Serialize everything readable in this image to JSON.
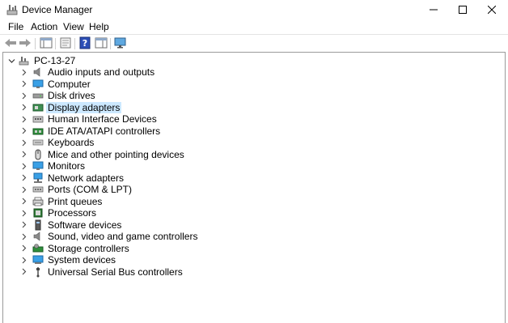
{
  "window": {
    "title": "Device Manager",
    "controls": {
      "minimize": "minimize-icon",
      "maximize": "maximize-icon",
      "close": "close-icon"
    }
  },
  "menu": [
    "File",
    "Action",
    "View",
    "Help"
  ],
  "toolbar": {
    "buttons": [
      "back-icon",
      "forward-icon",
      "show-hide-console-tree-icon",
      "properties-icon",
      "help-icon",
      "show-hide-action-pane-icon",
      "scan-hardware-icon"
    ]
  },
  "tree": {
    "root": "PC-13-27",
    "items": [
      {
        "label": "Audio inputs and outputs",
        "icon": "audio-icon"
      },
      {
        "label": "Computer",
        "icon": "computer-icon"
      },
      {
        "label": "Disk drives",
        "icon": "disk-drive-icon"
      },
      {
        "label": "Display adapters",
        "icon": "display-adapter-icon",
        "selected": true
      },
      {
        "label": "Human Interface Devices",
        "icon": "hid-icon"
      },
      {
        "label": "IDE ATA/ATAPI controllers",
        "icon": "ide-controller-icon"
      },
      {
        "label": "Keyboards",
        "icon": "keyboard-icon"
      },
      {
        "label": "Mice and other pointing devices",
        "icon": "mouse-icon"
      },
      {
        "label": "Monitors",
        "icon": "monitor-icon"
      },
      {
        "label": "Network adapters",
        "icon": "network-adapter-icon"
      },
      {
        "label": "Ports (COM & LPT)",
        "icon": "port-icon"
      },
      {
        "label": "Print queues",
        "icon": "printer-icon"
      },
      {
        "label": "Processors",
        "icon": "processor-icon"
      },
      {
        "label": "Software devices",
        "icon": "software-device-icon"
      },
      {
        "label": "Sound, video and game controllers",
        "icon": "sound-controller-icon"
      },
      {
        "label": "Storage controllers",
        "icon": "storage-controller-icon"
      },
      {
        "label": "System devices",
        "icon": "system-device-icon"
      },
      {
        "label": "Universal Serial Bus controllers",
        "icon": "usb-icon"
      }
    ]
  },
  "colors": {
    "selection": "#cce8ff",
    "border": "#9a9a9a"
  }
}
